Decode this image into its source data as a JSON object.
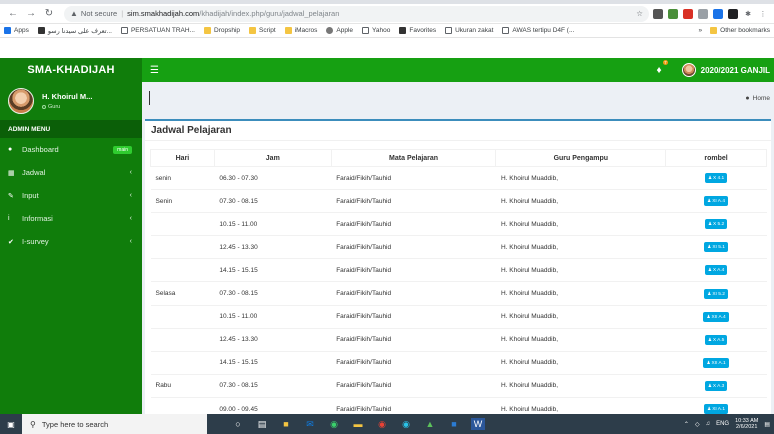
{
  "browser": {
    "security_label": "Not secure",
    "url_host": "sim.smakhadijah.com",
    "url_path": "/khadijah/index.php/guru/jadwal_pelajaran"
  },
  "bookmarks": {
    "items": [
      {
        "label": "Apps",
        "kind": "apps"
      },
      {
        "label": "تعرف على سيدنا رسو...",
        "kind": "page"
      },
      {
        "label": "PERSATUAN TRAH...",
        "kind": "globe"
      },
      {
        "label": "Dropship",
        "kind": "folder"
      },
      {
        "label": "Script",
        "kind": "folder"
      },
      {
        "label": "iMacros",
        "kind": "folder"
      },
      {
        "label": "Apple",
        "kind": "apple"
      },
      {
        "label": "Yahoo",
        "kind": "globe"
      },
      {
        "label": "Favorites",
        "kind": "page"
      },
      {
        "label": "Ukuran zakat",
        "kind": "globe"
      },
      {
        "label": "AWAS tertipu D4F (...",
        "kind": "globe"
      }
    ],
    "more": "»",
    "other": "Other bookmarks"
  },
  "app": {
    "brand": "SMA-KHADIJAH",
    "notif_count": "7",
    "period": "2020/2021 GANJIL"
  },
  "sidebar": {
    "user_name": "H. Khoirul M...",
    "user_role": "Guru",
    "menu_header": "ADMIN MENU",
    "items": [
      {
        "label": "Dashboard",
        "icon": "dashboard-icon",
        "badge": "main"
      },
      {
        "label": "Jadwal",
        "icon": "calendar-icon"
      },
      {
        "label": "Input",
        "icon": "pencil-icon"
      },
      {
        "label": "Informasi",
        "icon": "info-icon"
      },
      {
        "label": "I-survey",
        "icon": "check-icon"
      }
    ]
  },
  "breadcrumb": {
    "home": "Home"
  },
  "page": {
    "title": "Jadwal Pelajaran"
  },
  "table": {
    "headers": [
      "Hari",
      "Jam",
      "Mata Pelajaran",
      "Guru Pengampu",
      "rombel"
    ],
    "rows": [
      {
        "hari": "senin",
        "jam": "06.30 - 07.30",
        "mapel": "Faraid/Fikih/Tauhid",
        "guru": "H. Khoirul Muaddib,",
        "rombel": "X 4.1"
      },
      {
        "hari": "Senin",
        "jam": "07.30 - 08.15",
        "mapel": "Faraid/Fikih/Tauhid",
        "guru": "H. Khoirul Muaddib,",
        "rombel": "XI A.4"
      },
      {
        "hari": "",
        "jam": "10.15 - 11.00",
        "mapel": "Faraid/Fikih/Tauhid",
        "guru": "H. Khoirul Muaddib,",
        "rombel": "X 5.2"
      },
      {
        "hari": "",
        "jam": "12.45 - 13.30",
        "mapel": "Faraid/Fikih/Tauhid",
        "guru": "H. Khoirul Muaddib,",
        "rombel": "XI 5.1"
      },
      {
        "hari": "",
        "jam": "14.15 - 15.15",
        "mapel": "Faraid/Fikih/Tauhid",
        "guru": "H. Khoirul Muaddib,",
        "rombel": "X A.4"
      },
      {
        "hari": "Selasa",
        "jam": "07.30 - 08.15",
        "mapel": "Faraid/Fikih/Tauhid",
        "guru": "H. Khoirul Muaddib,",
        "rombel": "XI 5.2"
      },
      {
        "hari": "",
        "jam": "10.15 - 11.00",
        "mapel": "Faraid/Fikih/Tauhid",
        "guru": "H. Khoirul Muaddib,",
        "rombel": "XII A.4"
      },
      {
        "hari": "",
        "jam": "12.45 - 13.30",
        "mapel": "Faraid/Fikih/Tauhid",
        "guru": "H. Khoirul Muaddib,",
        "rombel": "X A.5"
      },
      {
        "hari": "",
        "jam": "14.15 - 15.15",
        "mapel": "Faraid/Fikih/Tauhid",
        "guru": "H. Khoirul Muaddib,",
        "rombel": "XII A.1"
      },
      {
        "hari": "Rabu",
        "jam": "07.30 - 08.15",
        "mapel": "Faraid/Fikih/Tauhid",
        "guru": "H. Khoirul Muaddib,",
        "rombel": "X A.3"
      },
      {
        "hari": "",
        "jam": "09.00 - 09.45",
        "mapel": "Faraid/Fikih/Tauhid",
        "guru": "H. Khoirul Muaddib,",
        "rombel": "XI A.1"
      }
    ]
  },
  "taskbar": {
    "search_placeholder": "Type here to search",
    "lang": "ENG",
    "time": "10:33 AM",
    "date": "2/6/2021"
  },
  "colors": {
    "sidebar": "#107d0b",
    "topbar": "#16a012",
    "rombel_badge": "#00a7e1",
    "box_border": "#3c8dbc"
  }
}
